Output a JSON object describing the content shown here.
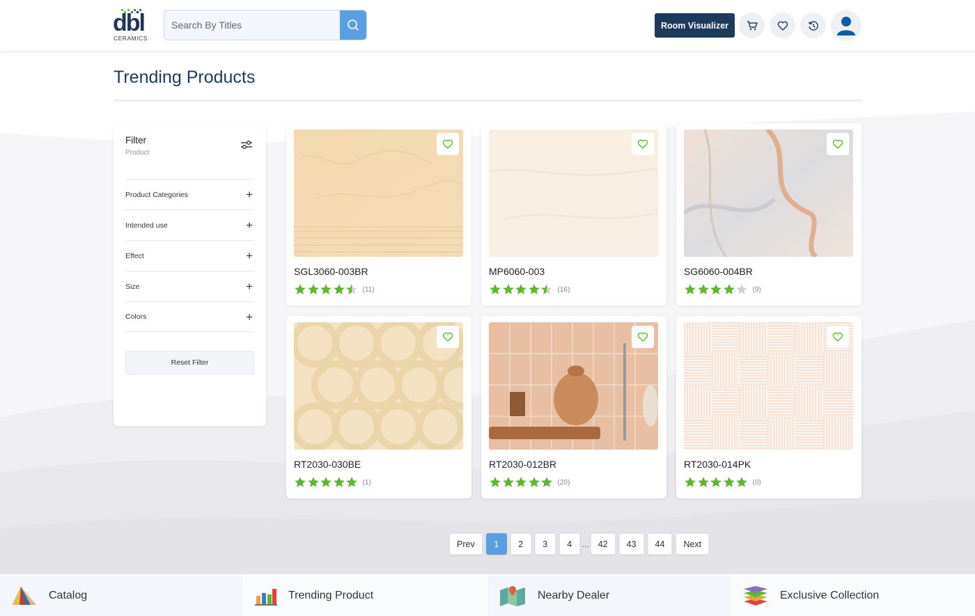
{
  "header": {
    "logo_text": "dbl",
    "logo_sub": "CERAMICS",
    "search_placeholder": "Search By Titles",
    "room_visualizer_label": "Room Visualizer"
  },
  "page": {
    "title": "Trending Products"
  },
  "filter": {
    "title": "Filter",
    "subtitle": "Product",
    "rows": [
      {
        "label": "Product Categories"
      },
      {
        "label": "Intended use"
      },
      {
        "label": "Effect"
      },
      {
        "label": "Size"
      },
      {
        "label": "Colors"
      }
    ],
    "reset_label": "Reset Filter"
  },
  "products": [
    {
      "name": "SGL3060-003BR",
      "rating": 4.5,
      "count": "(11)"
    },
    {
      "name": "MP6060-003",
      "rating": 4.5,
      "count": "(16)"
    },
    {
      "name": "SG6060-004BR",
      "rating": 4,
      "count": "(9)"
    },
    {
      "name": "RT2030-030BE",
      "rating": 5,
      "count": "(1)"
    },
    {
      "name": "RT2030-012BR",
      "rating": 5,
      "count": "(20)"
    },
    {
      "name": "RT2030-014PK",
      "rating": 5,
      "count": "(0)"
    }
  ],
  "pagination": {
    "prev": "Prev",
    "pages": [
      "1",
      "2",
      "3",
      "4",
      "42",
      "43",
      "44"
    ],
    "ellipsis": "...",
    "next": "Next",
    "current": "1"
  },
  "bottom_nav": [
    {
      "label": "Catalog",
      "icon": "catalog-icon"
    },
    {
      "label": "Trending Product",
      "icon": "bar-chart-icon"
    },
    {
      "label": "Nearby Dealer",
      "icon": "map-icon"
    },
    {
      "label": "Exclusive Collection",
      "icon": "layers-icon"
    }
  ],
  "colors": {
    "primary": "#1b3a5c",
    "accent": "#5b9fe3",
    "star": "#5cb82e",
    "heart": "#5cb82e"
  }
}
